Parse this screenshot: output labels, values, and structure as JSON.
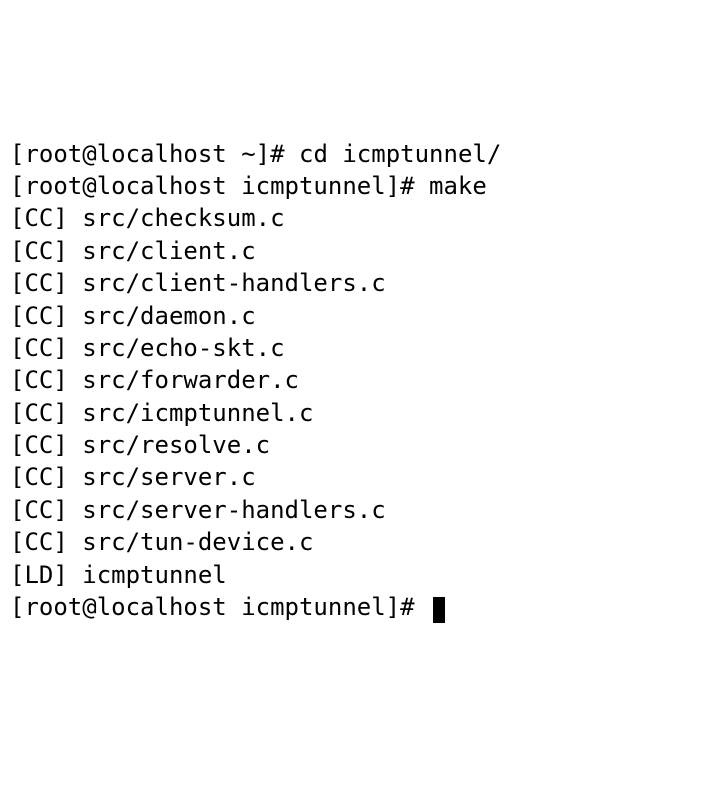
{
  "lines": [
    {
      "prompt": "[root@localhost ~]#",
      "cmd": " cd icmptunnel/"
    },
    {
      "prompt": "[root@localhost icmptunnel]#",
      "cmd": " make"
    },
    {
      "prompt": "[CC]",
      "cmd": " src/checksum.c"
    },
    {
      "prompt": "[CC]",
      "cmd": " src/client.c"
    },
    {
      "prompt": "[CC]",
      "cmd": " src/client-handlers.c"
    },
    {
      "prompt": "[CC]",
      "cmd": " src/daemon.c"
    },
    {
      "prompt": "[CC]",
      "cmd": " src/echo-skt.c"
    },
    {
      "prompt": "[CC]",
      "cmd": " src/forwarder.c"
    },
    {
      "prompt": "[CC]",
      "cmd": " src/icmptunnel.c"
    },
    {
      "prompt": "[CC]",
      "cmd": " src/resolve.c"
    },
    {
      "prompt": "[CC]",
      "cmd": " src/server.c"
    },
    {
      "prompt": "[CC]",
      "cmd": " src/server-handlers.c"
    },
    {
      "prompt": "[CC]",
      "cmd": " src/tun-device.c"
    },
    {
      "prompt": "[LD]",
      "cmd": " icmptunnel"
    }
  ],
  "final": {
    "prompt": "[root@localhost icmptunnel]#",
    "cmd": " "
  }
}
